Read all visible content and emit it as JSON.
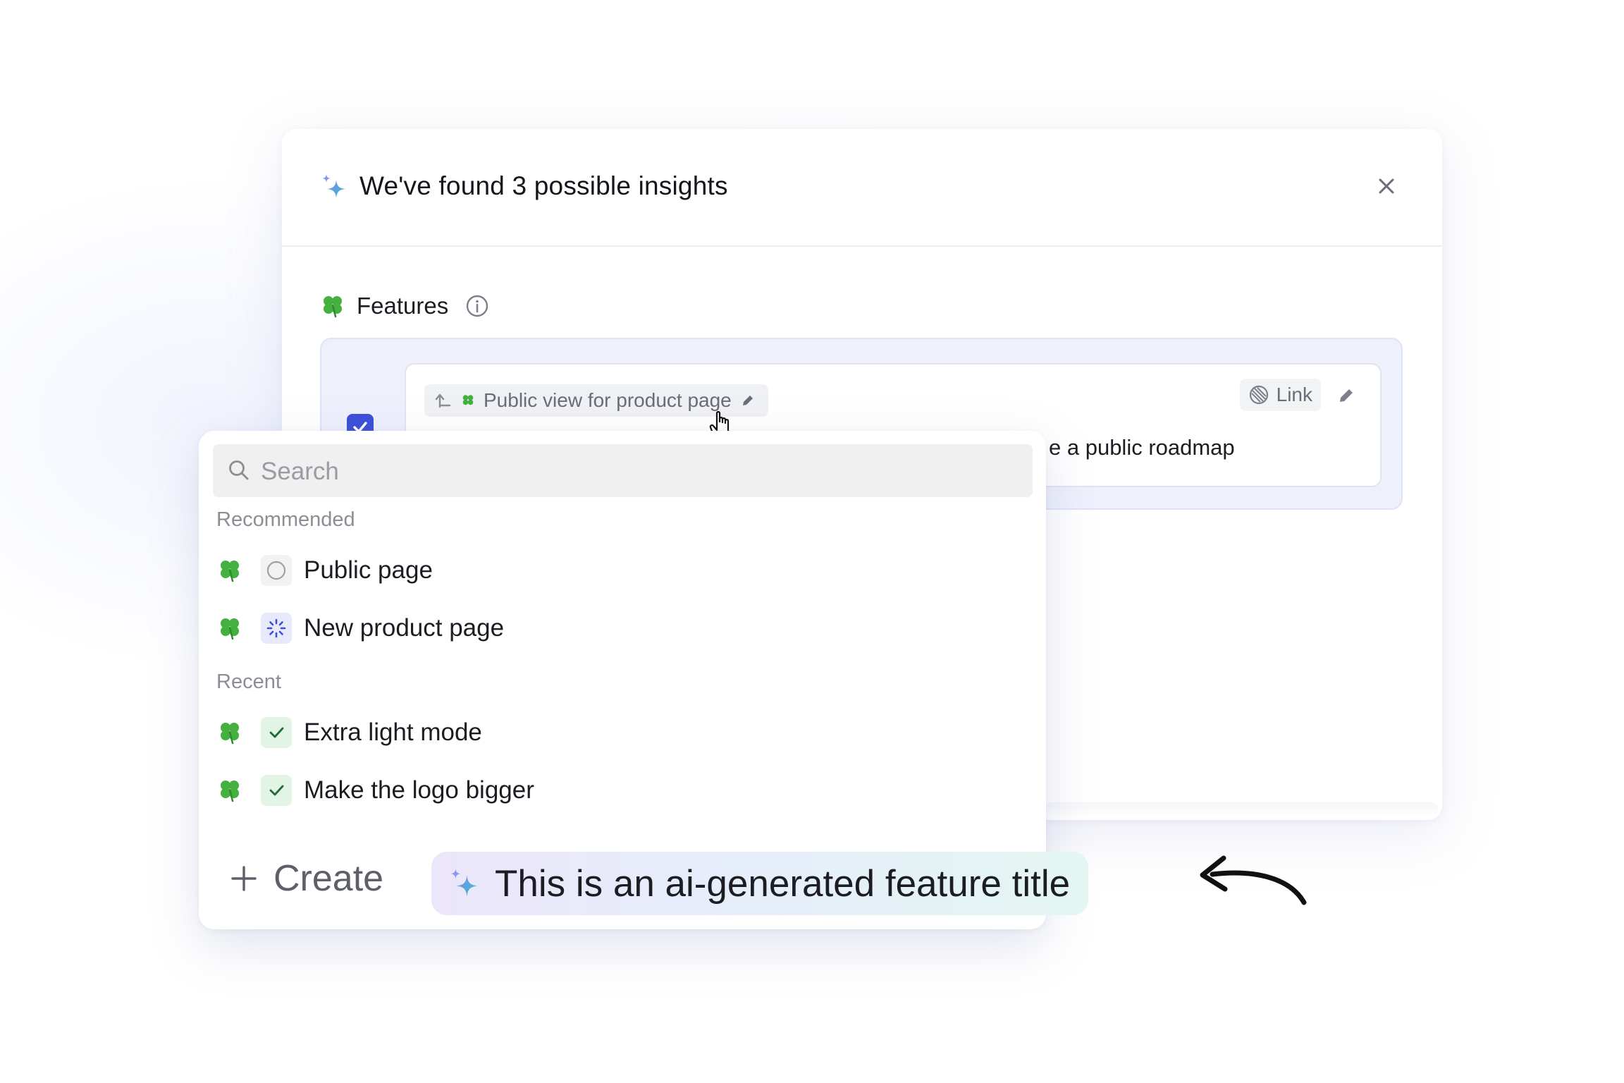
{
  "modal": {
    "title": "We've found 3 possible insights",
    "section": {
      "title": "Features"
    },
    "insight": {
      "parent_feature": "Public view for product page",
      "link_label": "Link",
      "text": "e a public roadmap",
      "checked": true
    }
  },
  "dropdown": {
    "search": {
      "placeholder": "Search",
      "value": ""
    },
    "groups": [
      {
        "label": "Recommended",
        "items": [
          {
            "label": "Public page",
            "status": "not-started"
          },
          {
            "label": "New product page",
            "status": "in-progress"
          }
        ]
      },
      {
        "label": "Recent",
        "items": [
          {
            "label": "Extra light mode",
            "status": "done"
          },
          {
            "label": "Make the logo bigger",
            "status": "done"
          }
        ]
      }
    ],
    "create_label": "Create",
    "ai_suggestion": "This is an ai-generated feature title"
  },
  "colors": {
    "accent": "#3b4fd8",
    "panel_bg": "#eef0fc",
    "leaf_green": "#3fae3a",
    "done_green": "#2e8b3f"
  }
}
